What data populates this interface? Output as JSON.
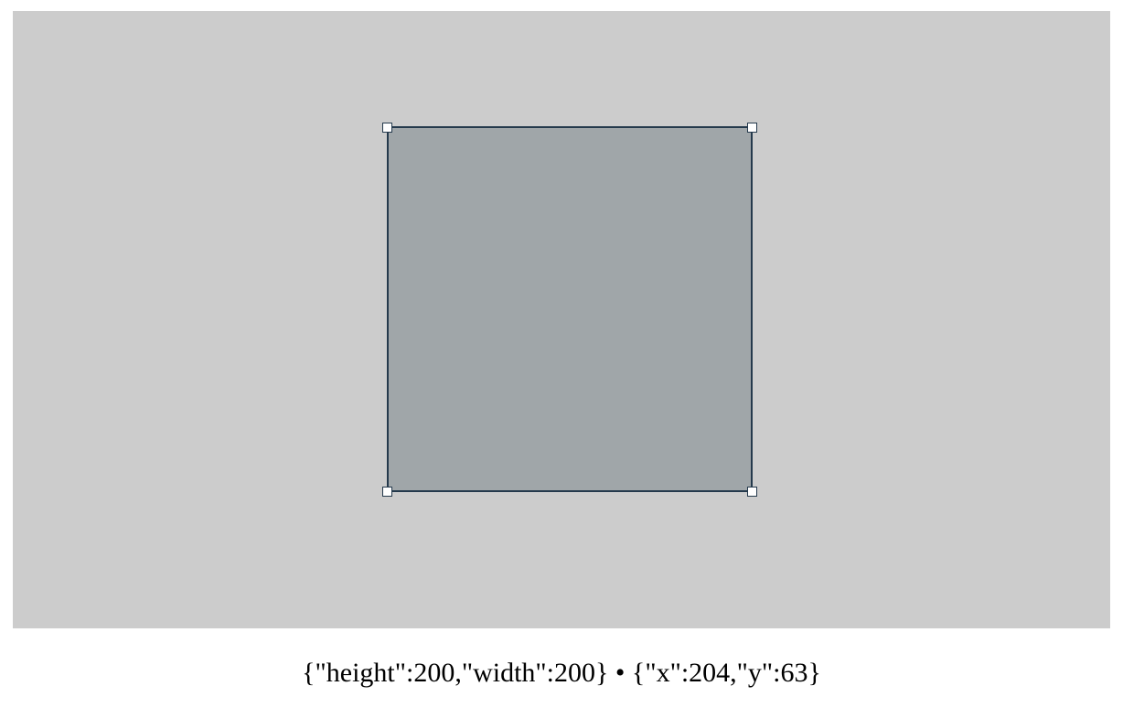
{
  "colors": {
    "canvas_background": "#cccccc",
    "shape_fill": "#a0a6a9",
    "shape_border": "#24394c",
    "handle_fill": "#ffffff"
  },
  "status": {
    "size_text": "{\"height\":200,\"width\":200}",
    "separator": "•",
    "position_text": "{\"x\":204,\"y\":63}"
  }
}
